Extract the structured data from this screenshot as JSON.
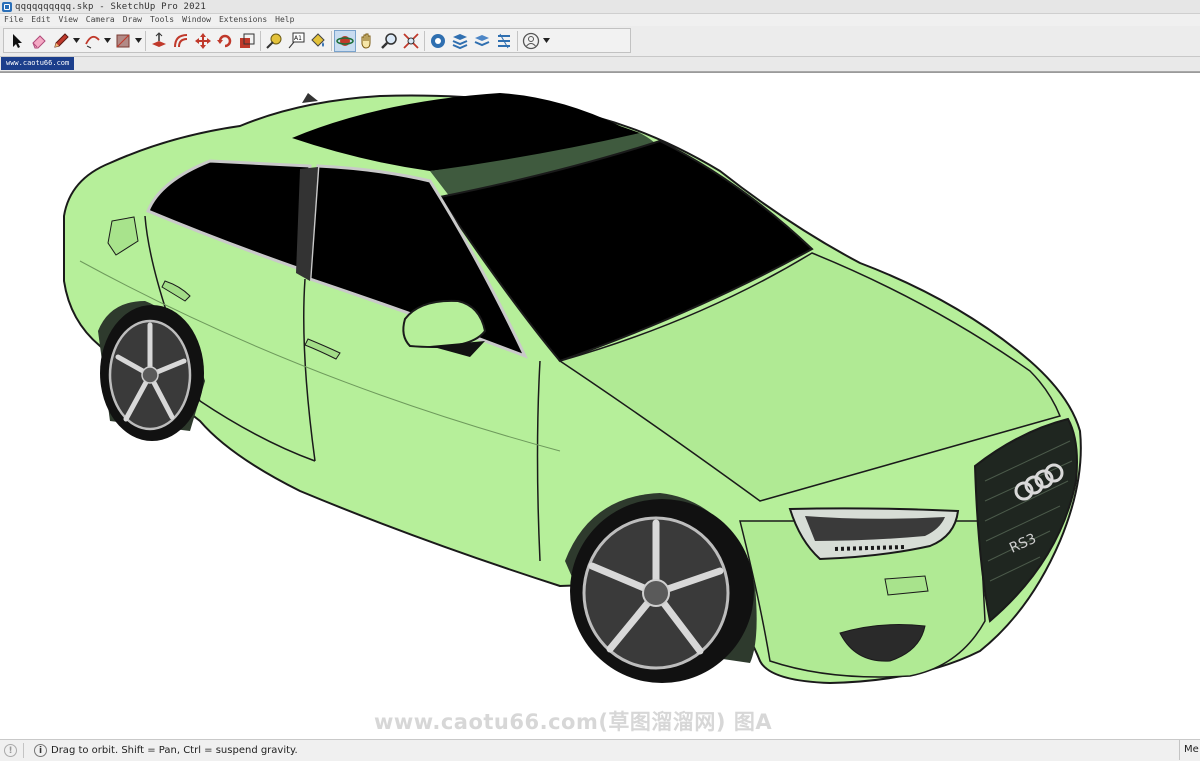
{
  "window": {
    "title": "qqqqqqqqqq.skp - SketchUp Pro 2021"
  },
  "menu": [
    "File",
    "Edit",
    "View",
    "Camera",
    "Draw",
    "Tools",
    "Window",
    "Extensions",
    "Help"
  ],
  "toolbar": {
    "tools": [
      {
        "name": "select-tool",
        "icon": "arrow-cursor-icon"
      },
      {
        "name": "eraser-tool",
        "icon": "eraser-icon"
      },
      {
        "name": "line-tool",
        "icon": "pencil-icon",
        "dropdown": true
      },
      {
        "name": "arc-tool",
        "icon": "arc-icon",
        "dropdown": true
      },
      {
        "name": "rectangle-tool",
        "icon": "rectangle-icon",
        "dropdown": true
      },
      {
        "name": "push-pull-tool",
        "icon": "push-pull-icon"
      },
      {
        "name": "offset-tool",
        "icon": "offset-icon"
      },
      {
        "name": "move-tool",
        "icon": "move-icon"
      },
      {
        "name": "rotate-tool",
        "icon": "rotate-icon"
      },
      {
        "name": "scale-tool",
        "icon": "scale-icon"
      },
      {
        "name": "tape-measure-tool",
        "icon": "tape-measure-icon"
      },
      {
        "name": "text-tool",
        "icon": "text-icon"
      },
      {
        "name": "paint-bucket-tool",
        "icon": "paint-bucket-icon"
      },
      {
        "name": "orbit-tool",
        "icon": "orbit-icon",
        "active": true
      },
      {
        "name": "pan-tool",
        "icon": "hand-icon"
      },
      {
        "name": "zoom-tool",
        "icon": "zoom-icon"
      },
      {
        "name": "zoom-extents-tool",
        "icon": "zoom-extents-icon"
      },
      {
        "name": "warehouse-tool",
        "icon": "3d-warehouse-icon"
      },
      {
        "name": "extension-warehouse-tool",
        "icon": "extension-warehouse-icon"
      },
      {
        "name": "layout-tool",
        "icon": "layout-icon"
      },
      {
        "name": "extension-manager-tool",
        "icon": "extension-manager-icon"
      },
      {
        "name": "account-tool",
        "icon": "user-account-icon",
        "dropdown": true
      }
    ],
    "text_tool_label": "A1"
  },
  "scene": {
    "tab_label": "www.caotu66.com"
  },
  "viewport": {
    "car_color": "#b6ef9a",
    "glass_color": "#000000",
    "grille_text": "RS3"
  },
  "watermark": "www.caotu66.com(草图溜溜网) 图A",
  "status": {
    "hint": "Drag to orbit. Shift = Pan, Ctrl = suspend gravity.",
    "info_icon": "i",
    "measurements_label": "Me"
  }
}
